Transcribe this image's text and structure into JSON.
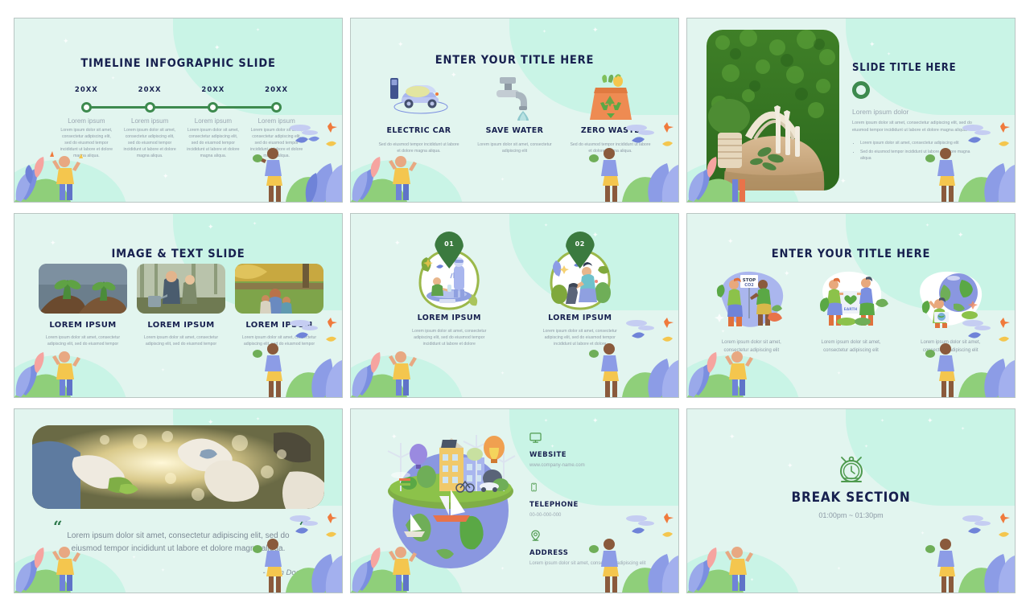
{
  "deck": {
    "theme": {
      "slide_bg": "#e2f5ef",
      "wave": "#c9f4e6",
      "title_navy": "#17204f",
      "accent_green": "#3d8a4e",
      "body_gray": "#8d9aa6"
    },
    "slides": [
      {
        "id": "timeline-infographic",
        "title": "TIMELINE INFOGRAPHIC SLIDE",
        "items": [
          {
            "year": "20XX",
            "heading": "Lorem ipsum",
            "body": "Lorem ipsum dolor sit amet, consectetur adipiscing elit, sed do eiusmod tempor incididunt ut labore et dolore magna aliqua."
          },
          {
            "year": "20XX",
            "heading": "Lorem ipsum",
            "body": "Lorem ipsum dolor sit amet, consectetur adipiscing elit, sed do eiusmod tempor incididunt ut labore et dolore magna aliqua."
          },
          {
            "year": "20XX",
            "heading": "Lorem ipsum",
            "body": "Lorem ipsum dolor sit amet, consectetur adipiscing elit, sed do eiusmod tempor incididunt ut labore et dolore magna aliqua."
          },
          {
            "year": "20XX",
            "heading": "Lorem ipsum",
            "body": "Lorem ipsum dolor sit amet, consectetur adipiscing elit, sed do eiusmod tempor incididunt ut labore et dolore magna aliqua."
          }
        ]
      },
      {
        "id": "three-icons",
        "title": "ENTER YOUR TITLE HERE",
        "items": [
          {
            "icon": "electric-car-icon",
            "label": "ELECTRIC CAR",
            "body": "Sed do eiusmod tempor incididunt ut labore et dolore magna aliqua."
          },
          {
            "icon": "water-faucet-icon",
            "label": "SAVE WATER",
            "body": "Lorem ipsum dolor sit amet, consectetur adipiscing elit"
          },
          {
            "icon": "recycle-bag-icon",
            "label": "ZERO WASTE",
            "body": "Sed do eiusmod tempor incididunt ut labore et dolore magna aliqua."
          }
        ]
      },
      {
        "id": "image-and-text",
        "title": "SLIDE TITLE HERE",
        "photo": "eco-tote-bag-photo",
        "lead": "Lorem ipsum dolor",
        "body": "Lorem ipsum dolor sit amet, consectetur adipiscing elit, sed do eiusmod tempor incididunt ut labore et dolore magna aliqua.",
        "bullets": [
          "Lorem ipsum dolor sit amet, consectetur adipiscing elit",
          "Sed do eiusmod tempor incididunt ut labore et dolore magna aliqua"
        ]
      },
      {
        "id": "image-text-cards",
        "title": "IMAGE & TEXT SLIDE",
        "items": [
          {
            "photo": "seedlings-in-hands-photo",
            "label": "LOREM IPSUM",
            "body": "Lorem ipsum dolor sit amet, consectetur adipiscing elit, sed do eiusmod tempor"
          },
          {
            "photo": "father-and-child-planting-photo",
            "label": "LOREM IPSUM",
            "body": "Lorem ipsum dolor sit amet, consectetur adipiscing elit, sed do eiusmod tempor"
          },
          {
            "photo": "family-gardening-photo",
            "label": "LOREM IPSUM",
            "body": "Lorem ipsum dolor sit amet, consectetur adipiscing elit, sed do eiusmod tempor"
          }
        ]
      },
      {
        "id": "numbered-pins",
        "items": [
          {
            "number": "01",
            "illustration": "scientists-testing-water-illustration",
            "label": "LOREM IPSUM",
            "body": "Lorem ipsum dolor sit amet, consectetur adipiscing elit, sed do eiusmod tempor incididunt ut labore et dolore"
          },
          {
            "number": "02",
            "illustration": "person-collecting-trash-illustration",
            "label": "LOREM IPSUM",
            "body": "Lorem ipsum dolor sit amet, consectetur adipiscing elit, sed do eiusmod tempor incididunt ut labore et dolore"
          }
        ]
      },
      {
        "id": "three-illustrations",
        "title": "ENTER YOUR TITLE HERE",
        "items": [
          {
            "illustration": "stop-co2-protest-illustration",
            "body": "Lorem ipsum dolor sit amet, consectetur adipiscing elit"
          },
          {
            "illustration": "love-earth-banner-illustration",
            "body": "Lorem ipsum dolor sit amet, consectetur adipiscing elit"
          },
          {
            "illustration": "globe-and-person-illustration",
            "body": "Lorem ipsum dolor sit amet, consectetur adipiscing elit"
          }
        ]
      },
      {
        "id": "quote",
        "photo": "hands-with-gloves-harvest-photo",
        "quote_open": "“",
        "quote_close": "”",
        "quote": "Lorem ipsum dolor sit amet, consectetur adipiscing elit, sed do eiusmod tempor incididunt ut labore et dolore magna aliqua.",
        "author": "- John Doe"
      },
      {
        "id": "contact",
        "illustration": "eco-city-globe-illustration",
        "rows": [
          {
            "icon": "monitor-icon",
            "label": "WEBSITE",
            "value": "www.company-name.com"
          },
          {
            "icon": "smartphone-icon",
            "label": "TELEPHONE",
            "value": "00-00-000-000"
          },
          {
            "icon": "location-pin-icon",
            "label": "ADDRESS",
            "value": "Lorem ipsum dolor sit amet, consectetur adipiscing elit"
          }
        ]
      },
      {
        "id": "break-section",
        "icon": "alarm-clock-icon",
        "title": "BREAK SECTION",
        "time": "01:00pm ~ 01:30pm"
      }
    ]
  }
}
